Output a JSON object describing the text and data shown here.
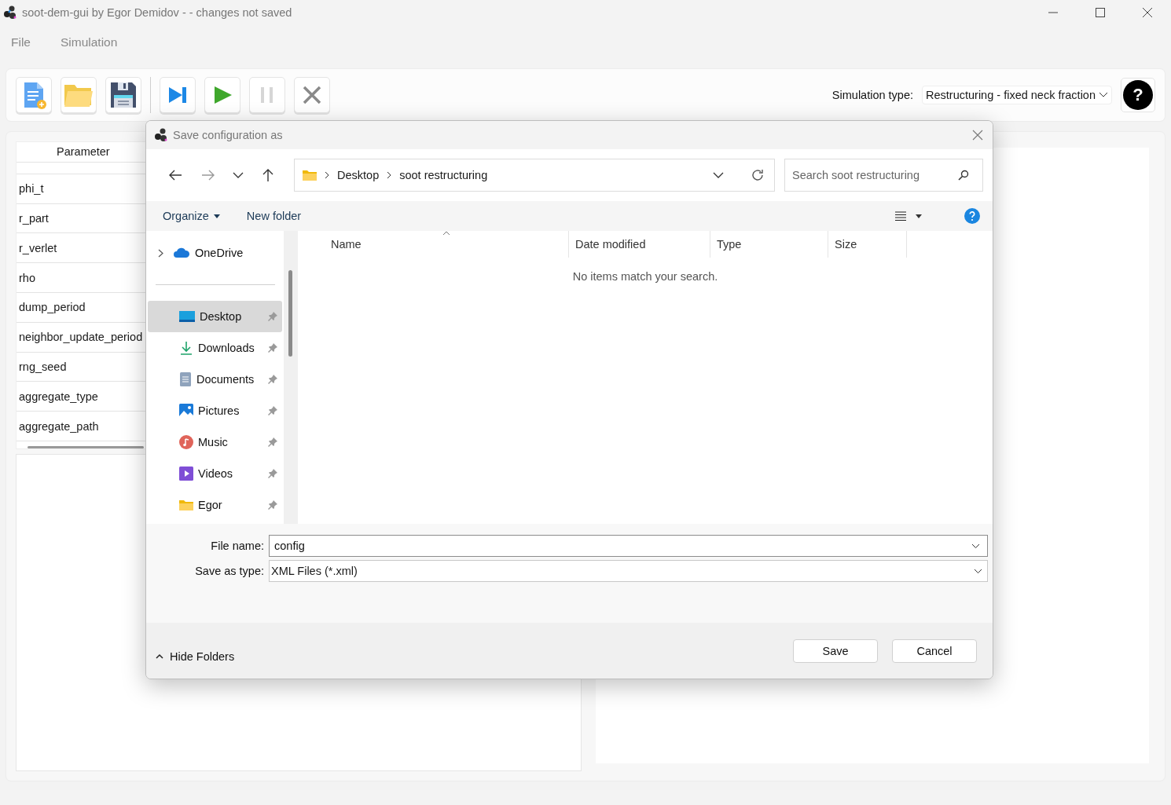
{
  "window": {
    "title": "soot-dem-gui by Egor Demidov -  - changes not saved"
  },
  "menu": [
    {
      "label": "File"
    },
    {
      "label": "Simulation"
    }
  ],
  "toolbar": {
    "buttons": [
      {
        "kind": "new",
        "disabled": false
      },
      {
        "kind": "open",
        "disabled": false
      },
      {
        "kind": "save",
        "disabled": false
      },
      {
        "kind": "step",
        "disabled": false
      },
      {
        "kind": "run",
        "disabled": false
      },
      {
        "kind": "pause",
        "disabled": true
      },
      {
        "kind": "stop",
        "disabled": false
      }
    ],
    "simulation_type_label": "Simulation type:",
    "simulation_type": "Restructuring - fixed neck fraction",
    "help": "?"
  },
  "parameters": {
    "header": "Parameter",
    "rows": [
      "phi_t",
      "r_part",
      "r_verlet",
      "rho",
      "dump_period",
      "neighbor_update_period",
      "rng_seed",
      "aggregate_type",
      "aggregate_path"
    ]
  },
  "dialog": {
    "title": "Save configuration as",
    "path": [
      "Desktop",
      "soot restructuring"
    ],
    "search_placeholder": "Search soot restructuring",
    "commands": [
      "Organize",
      "New folder"
    ],
    "nav": [
      {
        "label": "OneDrive",
        "kind": "cloud",
        "selected": false,
        "pinned": false
      },
      {
        "label": "Desktop",
        "kind": "desktop",
        "selected": true,
        "pinned": true
      },
      {
        "label": "Downloads",
        "kind": "downloads",
        "selected": false,
        "pinned": true
      },
      {
        "label": "Documents",
        "kind": "documents",
        "selected": false,
        "pinned": true
      },
      {
        "label": "Pictures",
        "kind": "pictures",
        "selected": false,
        "pinned": true
      },
      {
        "label": "Music",
        "kind": "music",
        "selected": false,
        "pinned": true
      },
      {
        "label": "Videos",
        "kind": "videos",
        "selected": false,
        "pinned": true
      },
      {
        "label": "Egor",
        "kind": "folder",
        "selected": false,
        "pinned": true
      }
    ],
    "columns": [
      "Name",
      "Date modified",
      "Type",
      "Size"
    ],
    "empty_message": "No items match your search.",
    "file_name_label": "File name:",
    "file_name": "config",
    "save_type_label": "Save as type:",
    "save_type": "XML Files (*.xml)",
    "hide_folders": "Hide Folders",
    "buttons": [
      "Save",
      "Cancel"
    ]
  }
}
